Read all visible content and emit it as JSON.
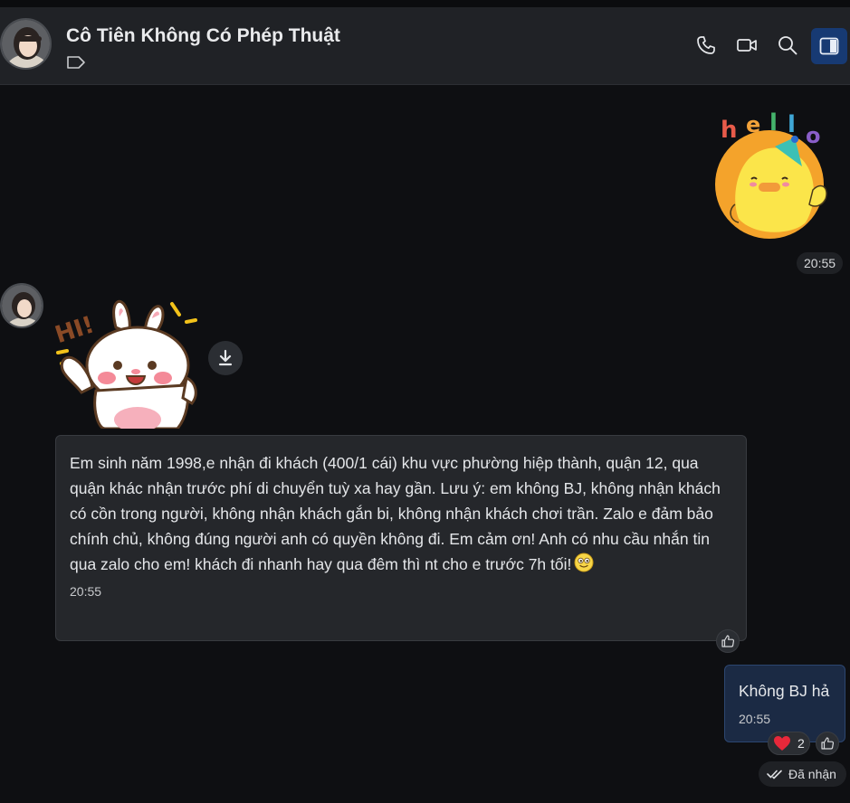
{
  "header": {
    "contact_name": "Cô Tiên Không Có Phép Thuật",
    "icons": [
      "tag-icon",
      "phone-icon",
      "video-icon",
      "search-icon",
      "side-panel-icon"
    ]
  },
  "messages": {
    "sticker_out": {
      "sticker_text": "hello",
      "time": "20:55"
    },
    "sticker_in": {
      "sticker_text": "HI!"
    },
    "text_in": {
      "text": "Em sinh năm 1998,e nhận đi khách (400/1 cái) khu vực phường hiệp thành, quận 12, qua quận khác nhận trước phí di chuyển tuỳ xa hay gần. Lưu ý: em không BJ, không nhận khách có cồn trong người, không nhận khách gắn bi, không nhận khách chơi trần. Zalo e đảm bảo chính chủ, không đúng người anh có quyền không đi. Em cảm ơn! Anh có nhu cầu nhắn tin qua zalo cho em! khách đi nhanh hay qua đêm thì nt cho e trước 7h tối!",
      "emoji": "smiling-face-emoji",
      "time": "20:55"
    },
    "text_out": {
      "text": "Không BJ hả",
      "time": "20:55",
      "reaction_count": "2",
      "status": "Đã nhận"
    }
  },
  "colors": {
    "background": "#0e0f12",
    "header": "#202226",
    "incoming_bubble": "#25272b",
    "outgoing_bubble": "#1b2a44",
    "accent": "#173a73"
  }
}
